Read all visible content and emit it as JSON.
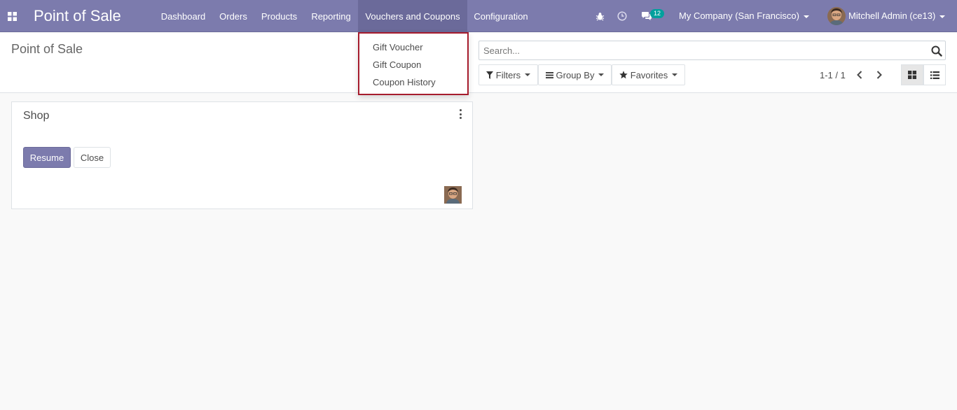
{
  "navbar": {
    "app_name": "Point of Sale",
    "menus": [
      "Dashboard",
      "Orders",
      "Products",
      "Reporting",
      "Vouchers and Coupons",
      "Configuration"
    ],
    "active_menu": "Vouchers and Coupons",
    "messages_count": "12",
    "company": "My Company (San Francisco)",
    "user": "Mitchell Admin (ce13)",
    "color": "#7c7bad"
  },
  "dropdown": {
    "items": [
      "Gift Voucher",
      "Gift Coupon",
      "Coupon History"
    ]
  },
  "control_panel": {
    "breadcrumb": "Point of Sale",
    "search_placeholder": "Search...",
    "filters_label": "Filters",
    "groupby_label": "Group By",
    "favorites_label": "Favorites",
    "pager": "1-1 / 1"
  },
  "card": {
    "title": "Shop",
    "resume_label": "Resume",
    "close_label": "Close"
  }
}
